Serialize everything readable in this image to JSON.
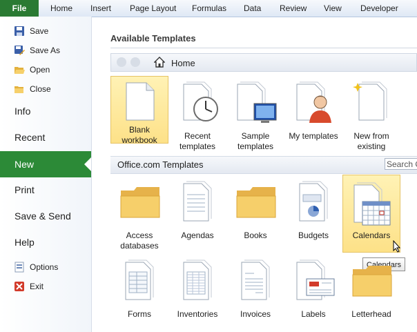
{
  "ribbon": {
    "file_tab": "File",
    "tabs": [
      "Home",
      "Insert",
      "Page Layout",
      "Formulas",
      "Data",
      "Review",
      "View",
      "Developer"
    ]
  },
  "backstage": {
    "commands": [
      {
        "label": "Save",
        "icon": "save-icon"
      },
      {
        "label": "Save As",
        "icon": "save-as-icon"
      },
      {
        "label": "Open",
        "icon": "open-folder-icon"
      },
      {
        "label": "Close",
        "icon": "close-folder-icon"
      }
    ],
    "nav": [
      "Info",
      "Recent",
      "New",
      "Print",
      "Save & Send",
      "Help"
    ],
    "selected_nav": "New",
    "bottom_commands": [
      {
        "label": "Options",
        "icon": "options-icon"
      },
      {
        "label": "Exit",
        "icon": "exit-icon"
      }
    ]
  },
  "main": {
    "heading": "Available Templates",
    "breadcrumb_home": "Home",
    "templates": [
      {
        "label_line1": "Blank",
        "label_line2": "workbook",
        "icon": "blank-workbook-icon",
        "selected": true
      },
      {
        "label_line1": "Recent",
        "label_line2": "templates",
        "icon": "recent-templates-icon"
      },
      {
        "label_line1": "Sample",
        "label_line2": "templates",
        "icon": "sample-templates-icon"
      },
      {
        "label_line1": "My templates",
        "label_line2": "",
        "icon": "my-templates-icon"
      },
      {
        "label_line1": "New from",
        "label_line2": "existing",
        "icon": "new-from-existing-icon"
      }
    ],
    "office_section_label": "Office.com Templates",
    "search_placeholder": "Search O",
    "office_templates_row1": [
      {
        "label_line1": "Access",
        "label_line2": "databases",
        "icon": "folder-icon"
      },
      {
        "label_line1": "Agendas",
        "label_line2": "",
        "icon": "agendas-icon"
      },
      {
        "label_line1": "Books",
        "label_line2": "",
        "icon": "folder-icon"
      },
      {
        "label_line1": "Budgets",
        "label_line2": "",
        "icon": "budgets-icon"
      },
      {
        "label_line1": "Calendars",
        "label_line2": "",
        "icon": "calendar-icon",
        "hovered": true
      }
    ],
    "office_templates_row2": [
      {
        "label_line1": "Forms",
        "label_line2": "",
        "icon": "forms-icon"
      },
      {
        "label_line1": "Inventories",
        "label_line2": "",
        "icon": "inventories-icon"
      },
      {
        "label_line1": "Invoices",
        "label_line2": "",
        "icon": "invoices-icon"
      },
      {
        "label_line1": "Labels",
        "label_line2": "",
        "icon": "labels-icon"
      },
      {
        "label_line1": "Letterhead",
        "label_line2": "",
        "icon": "folder-icon"
      }
    ],
    "tooltip": "Calendars"
  },
  "colors": {
    "file_tab": "#2a7a33",
    "nav_selected": "#2c8a37",
    "tile_selected": "#fde188",
    "folder": "#f2c457"
  }
}
